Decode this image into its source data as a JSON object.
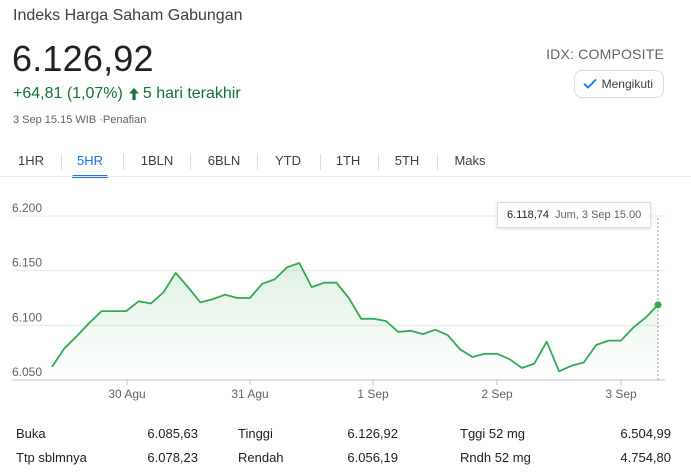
{
  "header": {
    "title": "Indeks Harga Saham Gabungan",
    "price": "6.126,92",
    "change": "+64,81 (1,07%)",
    "change_period": "5 hari terakhir",
    "timestamp": "3 Sep 15.15 WIB",
    "disclaimer_sep": "·",
    "disclaimer": "Penafian",
    "ticker": "IDX: COMPOSITE",
    "follow_label": "Mengikuti",
    "positive_color": "#137333",
    "accent_color": "#1a73e8"
  },
  "tabs": [
    "1HR",
    "5HR",
    "1BLN",
    "6BLN",
    "YTD",
    "1TH",
    "5TH",
    "Maks"
  ],
  "active_tab": "5HR",
  "tooltip": {
    "value": "6.118,74",
    "time": "Jum, 3 Sep 15.00"
  },
  "chart_data": {
    "type": "line",
    "title": "",
    "xlabel": "",
    "ylabel": "",
    "ylim": [
      6050,
      6200
    ],
    "yticks": [
      "6.200",
      "6.150",
      "6.100",
      "6.050"
    ],
    "x_tick_labels": [
      "30 Agu",
      "31 Agu",
      "1 Sep",
      "2 Sep",
      "3 Sep"
    ],
    "series": [
      {
        "values": [
          6062,
          6079,
          6090,
          6102,
          6113,
          6113,
          6113,
          6122,
          6120,
          6130,
          6148,
          6135,
          6121,
          6124,
          6128,
          6125,
          6125,
          6138,
          6142,
          6153,
          6157,
          6135,
          6139,
          6139,
          6125,
          6106,
          6106,
          6104,
          6094,
          6095,
          6092,
          6096,
          6091,
          6078,
          6071,
          6074,
          6074,
          6069,
          6061,
          6065,
          6085,
          6058,
          6063,
          6066,
          6082,
          6086,
          6086,
          6098,
          6107,
          6118.74
        ]
      }
    ],
    "grid": true,
    "line_color": "#34a853"
  },
  "stats": {
    "rows": [
      [
        {
          "label": "Buka",
          "value": "6.085,63"
        },
        {
          "label": "Tinggi",
          "value": "6.126,92"
        },
        {
          "label": "Tggi 52 mg",
          "value": "6.504,99"
        }
      ],
      [
        {
          "label": "Ttp sblmnya",
          "value": "6.078,23"
        },
        {
          "label": "Rendah",
          "value": "6.056,19"
        },
        {
          "label": "Rndh 52 mg",
          "value": "4.754,80"
        }
      ]
    ]
  }
}
